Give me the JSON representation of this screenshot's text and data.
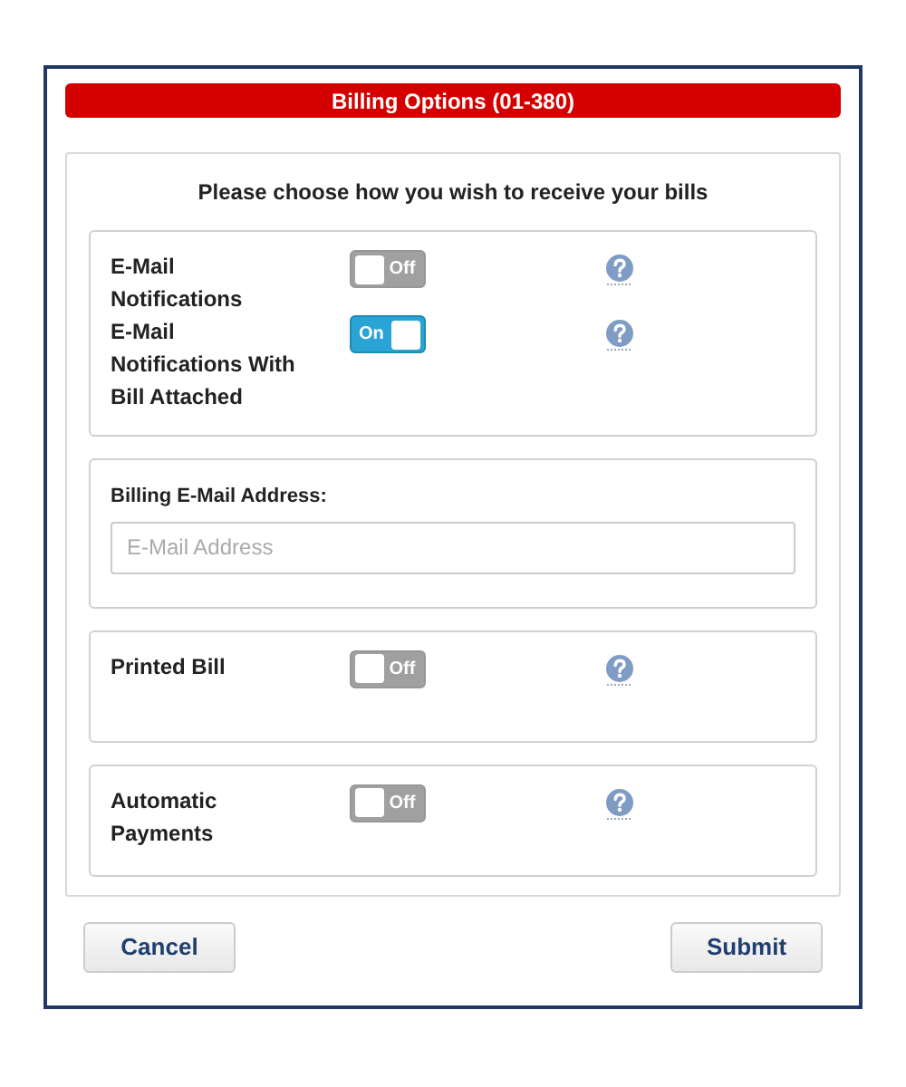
{
  "title": "Billing Options (01-380)",
  "instruction": "Please choose how you wish to receive your bills",
  "sections": [
    {
      "kind": "toggles",
      "rows": [
        {
          "label": "E-Mail Notifications",
          "on": false,
          "toggle_text": "Off"
        },
        {
          "label": "E-Mail Notifications With Bill Attached",
          "on": true,
          "toggle_text": "On"
        }
      ]
    },
    {
      "kind": "field",
      "label": "Billing E-Mail Address:",
      "placeholder": "E-Mail Address"
    },
    {
      "kind": "toggles",
      "rows": [
        {
          "label": "Printed Bill",
          "on": false,
          "toggle_text": "Off"
        }
      ]
    },
    {
      "kind": "toggles",
      "rows": [
        {
          "label": "Automatic Payments",
          "on": false,
          "toggle_text": "Off"
        }
      ]
    }
  ],
  "buttons": {
    "cancel": "Cancel",
    "submit": "Submit"
  }
}
